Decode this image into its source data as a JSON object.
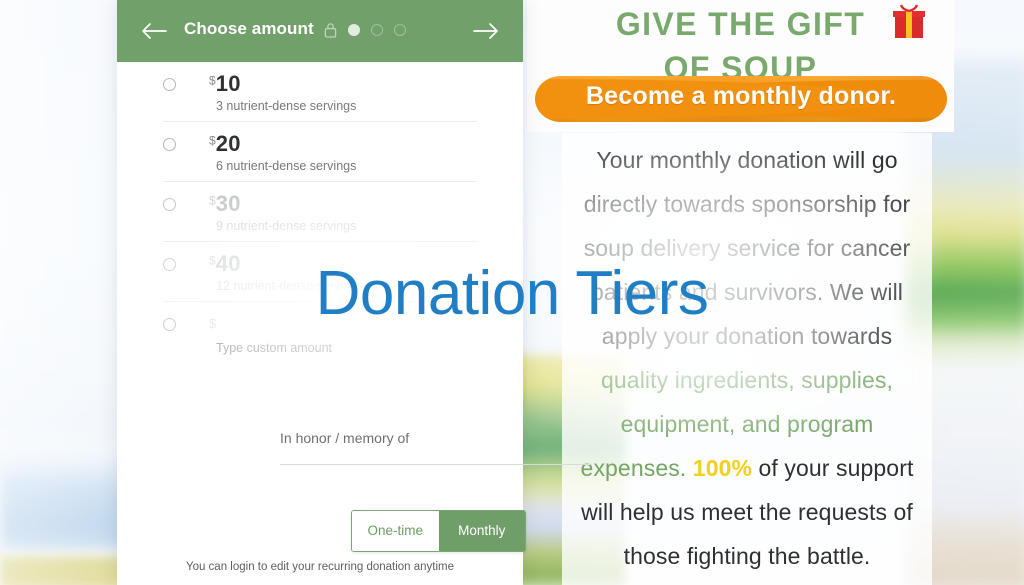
{
  "overlay": {
    "title": "Donation Tiers",
    "color": "#1f7ec4"
  },
  "theme": {
    "brand_green": "#6f9e68",
    "header_green": "#71a06a",
    "promo_green": "#79a96d",
    "brush_orange": "#f39412",
    "accent_yellow": "#f5cf1c",
    "overlay_blue": "#1f7ec4"
  },
  "card": {
    "header": {
      "back_icon": "arrow-left-icon",
      "title": "Choose amount",
      "lock_icon": "lock-icon",
      "next_icon": "arrow-right-icon",
      "steps": [
        {
          "state": "active"
        },
        {
          "state": "inactive"
        },
        {
          "state": "inactive"
        }
      ]
    },
    "tiers": [
      {
        "currency": "$",
        "amount": "10",
        "desc": "3 nutrient-dense servings",
        "faded": false
      },
      {
        "currency": "$",
        "amount": "20",
        "desc": "6 nutrient-dense servings",
        "faded": false
      },
      {
        "currency": "$",
        "amount": "30",
        "desc": "9 nutrient-dense servings",
        "faded": true
      },
      {
        "currency": "$",
        "amount": "40",
        "desc": "12 nutrient-dense servings",
        "faded": true
      }
    ],
    "custom_tier": {
      "currency": "$",
      "amount": "",
      "placeholder": "Type custom amount",
      "desc": "Type custom amount"
    },
    "honor": {
      "label": "In honor / memory of",
      "value": "",
      "placeholder": "In honor / memory of"
    },
    "frequency": {
      "one_time_label": "One-time",
      "monthly_label": "Monthly",
      "selected": "Monthly",
      "note": "You can login to edit your recurring donation anytime"
    }
  },
  "promo": {
    "heading_line1": "GIVE THE GIFT",
    "heading_line2": "OF SOUP",
    "gift_icon": "gift-box-icon",
    "banner": "Become a monthly donor.",
    "body": {
      "part1": "Your monthly donation will go directly towards sponsorship for soup delivery service for cancer patients and survivors. We will apply your donation towards ",
      "green": "quality ingredients, supplies, equipment, and program expenses.",
      "space": " ",
      "highlight": "100%",
      "part2": " of your support will help us meet the requests of those fighting the battle."
    }
  }
}
